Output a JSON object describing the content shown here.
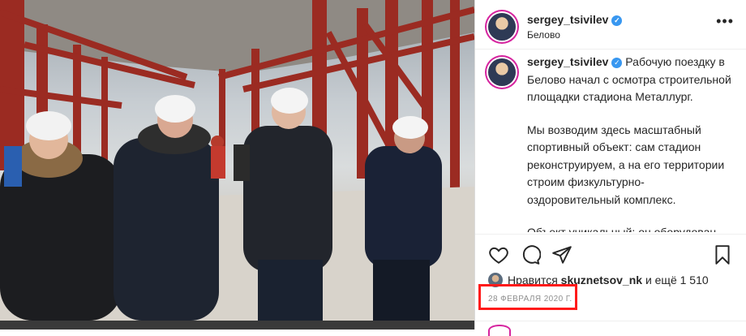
{
  "post": {
    "username": "sergey_tsivilev",
    "location": "Белово",
    "caption_paragraphs": [
      "Рабочую поездку в Белово начал с осмотра строительной площадки стадиона Металлург.",
      "Мы возводим здесь масштабный спортивный объект: сам стадион реконструируем, а на его территории строим физкультурно-оздоровительный комплекс.",
      "Объект уникальный: он оборудован для спортсменов с ограниченными"
    ],
    "likes_prefix": "Нравится",
    "liker": "skuznetsov_nk",
    "likes_suffix": "и ещё 1 510",
    "date": "28 февраля 2020 г."
  },
  "icons": {
    "verified": "verified-badge-icon",
    "more": "more-options-icon",
    "like": "heart-icon",
    "comment": "comment-icon",
    "share": "share-icon",
    "save": "bookmark-icon"
  },
  "colors": {
    "highlight": "#ff1a1a",
    "verified": "#3897f0",
    "ring": "#d6249f"
  }
}
